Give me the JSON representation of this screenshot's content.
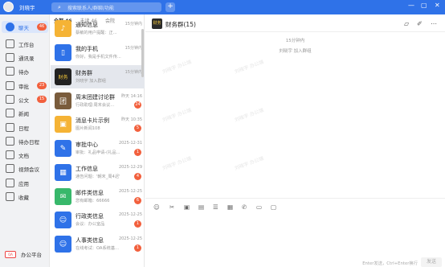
{
  "titlebar": {
    "user": "刘晓宇",
    "search_placeholder": "搜索联系人/群聊/功能"
  },
  "sidebar": {
    "items": [
      {
        "label": "聊天",
        "icon": "chat-icon",
        "badge": "46"
      },
      {
        "label": "工作台",
        "icon": "workbench-icon",
        "badge": ""
      },
      {
        "label": "通讯录",
        "icon": "contacts-icon",
        "badge": ""
      },
      {
        "label": "待办",
        "icon": "todo-icon",
        "badge": ""
      },
      {
        "label": "审批",
        "icon": "approval-icon",
        "badge": "23"
      },
      {
        "label": "公文",
        "icon": "document-icon",
        "badge": "15"
      },
      {
        "label": "新闻",
        "icon": "news-icon",
        "badge": ""
      },
      {
        "label": "日程",
        "icon": "calendar-icon",
        "badge": ""
      },
      {
        "label": "待办日程",
        "icon": "todo-schedule-icon",
        "badge": ""
      },
      {
        "label": "文档",
        "icon": "docs-icon",
        "badge": ""
      },
      {
        "label": "视频会议",
        "icon": "video-meeting-icon",
        "badge": ""
      },
      {
        "label": "应用",
        "icon": "apps-icon",
        "badge": ""
      },
      {
        "label": "收藏",
        "icon": "favorites-icon",
        "badge": ""
      }
    ],
    "office_label": "办公平台"
  },
  "list": {
    "tabs": [
      "全部 46",
      "未读 46",
      "会院"
    ],
    "conversations": [
      {
        "name": "通知信息",
        "preview": "蔡敏的用户提醒：正...",
        "time": "15分钟内",
        "badge": "",
        "color": "#f5b335",
        "glyph": "♪"
      },
      {
        "name": "我的手机",
        "preview": "你好，我是手机文件传...",
        "time": "15分钟内",
        "badge": "",
        "color": "#2f72e8",
        "glyph": "▯"
      },
      {
        "name": "财务群",
        "preview": "刘晓宇 加入群组",
        "time": "15分钟内",
        "badge": "",
        "color": "#222",
        "glyph": "财务"
      },
      {
        "name": "周末团建讨论群",
        "preview": "行政助理:周末会议...",
        "time": "昨天 14:16",
        "badge": "24",
        "color": "#7a5c3c",
        "glyph": "团"
      },
      {
        "name": "消息卡片示例",
        "preview": "图片新闻108",
        "time": "昨天 10:35",
        "badge": "5",
        "color": "#f5b335",
        "glyph": "▣"
      },
      {
        "name": "审批中心",
        "preview": "审批：礼品申请-(礼品...",
        "time": "2025-12-31",
        "badge": "1",
        "color": "#2f72e8",
        "glyph": "✎"
      },
      {
        "name": "工作信息",
        "preview": "通告问题：'朝末_周4迟'",
        "time": "2025-12-29",
        "badge": "4",
        "color": "#2f72e8",
        "glyph": "▦"
      },
      {
        "name": "邮件类信息",
        "preview": "您有邮箱：66666",
        "time": "2025-12-25",
        "badge": "6",
        "color": "#38b86b",
        "glyph": "✉"
      },
      {
        "name": "行政类信息",
        "preview": "会议：办公室品",
        "time": "2025-12-25",
        "badge": "1",
        "color": "#2f72e8",
        "glyph": "☺"
      },
      {
        "name": "人事类信息",
        "preview": "在线考试：OA系统基...",
        "time": "2025-12-25",
        "badge": "1",
        "color": "#2f72e8",
        "glyph": "☺"
      }
    ]
  },
  "chat": {
    "avatar_text": "财务",
    "title": "财务群(15)",
    "time_label": "15分钟内",
    "system_msg": "刘晓宇 加入群组",
    "hint": "Enter发送，Ctrl+Enter换行",
    "send_label": "发送",
    "watermark": "刘晓宇 办公端"
  }
}
